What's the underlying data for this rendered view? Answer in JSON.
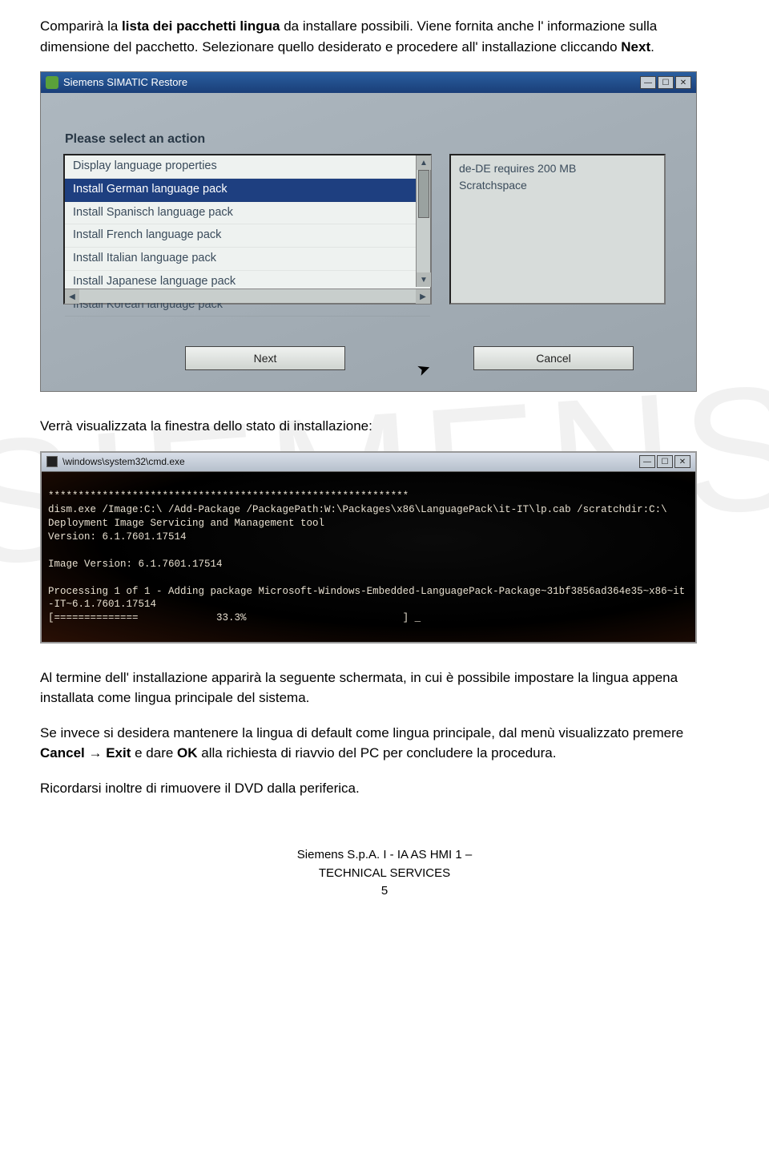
{
  "watermark": "SIEMENS",
  "para1": {
    "t1": "Comparirà la ",
    "b1": "lista dei pacchetti lingua",
    "t2": " da installare possibili. Viene fornita anche l' informazione sulla dimensione del pacchetto. Selezionare quello desiderato e procedere all' installazione cliccando ",
    "b2": "Next",
    "t3": "."
  },
  "screenshot1": {
    "title": "Siemens SIMATIC Restore",
    "label": "Please select an action",
    "items": [
      "Display language properties",
      "Install German language pack",
      "Install Spanisch language pack",
      "Install French language pack",
      "Install Italian language pack",
      "Install Japanese language pack",
      "Install Korean language pack"
    ],
    "selected_index": 1,
    "info_line1": "de-DE requires 200 MB",
    "info_line2": "Scratchspace",
    "btn_next": "Next",
    "btn_cancel": "Cancel"
  },
  "para2": "Verrà visualizzata la finestra dello stato di installazione:",
  "screenshot2": {
    "title": "\\windows\\system32\\cmd.exe",
    "lines": [
      "************************************************************",
      "dism.exe /Image:C:\\ /Add-Package /PackagePath:W:\\Packages\\x86\\LanguagePack\\it-IT\\lp.cab /scratchdir:C:\\",
      "Deployment Image Servicing and Management tool",
      "Version: 6.1.7601.17514",
      "",
      "Image Version: 6.1.7601.17514",
      "",
      "Processing 1 of 1 - Adding package Microsoft-Windows-Embedded-LanguagePack-Package~31bf3856ad364e35~x86~it-IT~6.1.7601.17514",
      "[==============             33.3%                          ] _"
    ]
  },
  "para3": "Al termine dell' installazione apparirà la seguente schermata, in cui è possibile impostare la lingua appena installata come lingua principale del sistema.",
  "para4": {
    "t1": "Se invece si desidera mantenere la lingua di default come lingua principale, dal menù visualizzato premere ",
    "b1": "Cancel",
    "arrow": " → ",
    "b2": "Exit",
    "t2": " e dare ",
    "b3": "OK",
    "t3": " alla richiesta di riavvio del PC per concludere la procedura."
  },
  "para5": "Ricordarsi inoltre di rimuovere il DVD dalla periferica.",
  "footer": {
    "line1": "Siemens S.p.A.  I - IA AS HMI 1 –",
    "line2": "TECHNICAL SERVICES",
    "page": "5"
  }
}
